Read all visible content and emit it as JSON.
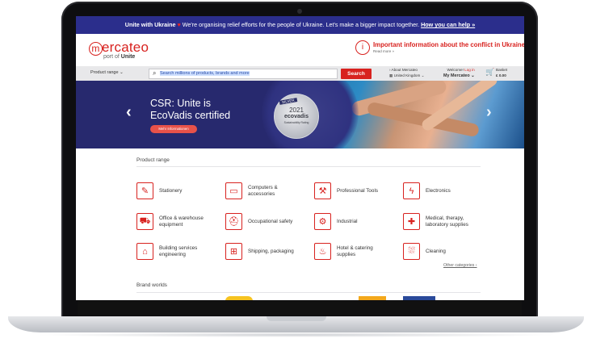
{
  "banner": {
    "lead": "Unite with Ukraine",
    "heart": "♥",
    "text": " We're organising relief efforts for the people of Ukraine. Let's make a bigger impact together. ",
    "link": "How you can help »"
  },
  "header": {
    "logo_mark": "m",
    "logo_text": "ercateo",
    "logo_sub_prefix": "port of ",
    "logo_sub_bold": "Unite",
    "info_icon": "i",
    "info_title": "Important information about the conflict in Ukraine",
    "info_sub": "Read more »"
  },
  "navbar": {
    "product_range": "Product range ⌄",
    "search_icon": "⌕",
    "search_placeholder": "Search millions of products, brands and more",
    "search_button": "Search",
    "about_line1": "› About Mercateo",
    "about_line2": "United Kingdom ⌄",
    "welcome_line1_prefix": "Welcome! ",
    "welcome_login": "Log in",
    "welcome_line2": "My Mercateo ⌄",
    "basket_line1": "Basket",
    "basket_line2": "£ 0.00"
  },
  "hero": {
    "prev": "‹",
    "next": "›",
    "title_line1": "CSR: Unite is",
    "title_line2": "EcoVadis certified",
    "cta": "Mehr Informationen",
    "badge_silver": "SILVER",
    "badge_year": "2021",
    "badge_brand": "ecovadis",
    "badge_text": "Sustainability Rating",
    "slides_total": 6,
    "active_slide": 6
  },
  "product_range": {
    "title": "Product range",
    "categories": [
      {
        "label": "Stationery",
        "icon": "✎"
      },
      {
        "label": "Computers &\naccessories",
        "icon": "▭"
      },
      {
        "label": "Professional Tools",
        "icon": "⚒"
      },
      {
        "label": "Electronics",
        "icon": "ϟ"
      },
      {
        "label": "Office & warehouse\nequipment",
        "icon": "⛟"
      },
      {
        "label": "Occupational safety",
        "icon": "⛑"
      },
      {
        "label": "Industrial",
        "icon": "⚙"
      },
      {
        "label": "Medical, therapy,\nlaboratory supplies",
        "icon": "✚"
      },
      {
        "label": "Building services\nengineering",
        "icon": "⌂"
      },
      {
        "label": "Shipping, packaging",
        "icon": "⊞"
      },
      {
        "label": "Hotel & catering\nsupplies",
        "icon": "♨"
      },
      {
        "label": "Cleaning",
        "icon": "⛆"
      }
    ],
    "other_link": "Other categories ›"
  },
  "brand_worlds": {
    "title": "Brand worlds"
  }
}
